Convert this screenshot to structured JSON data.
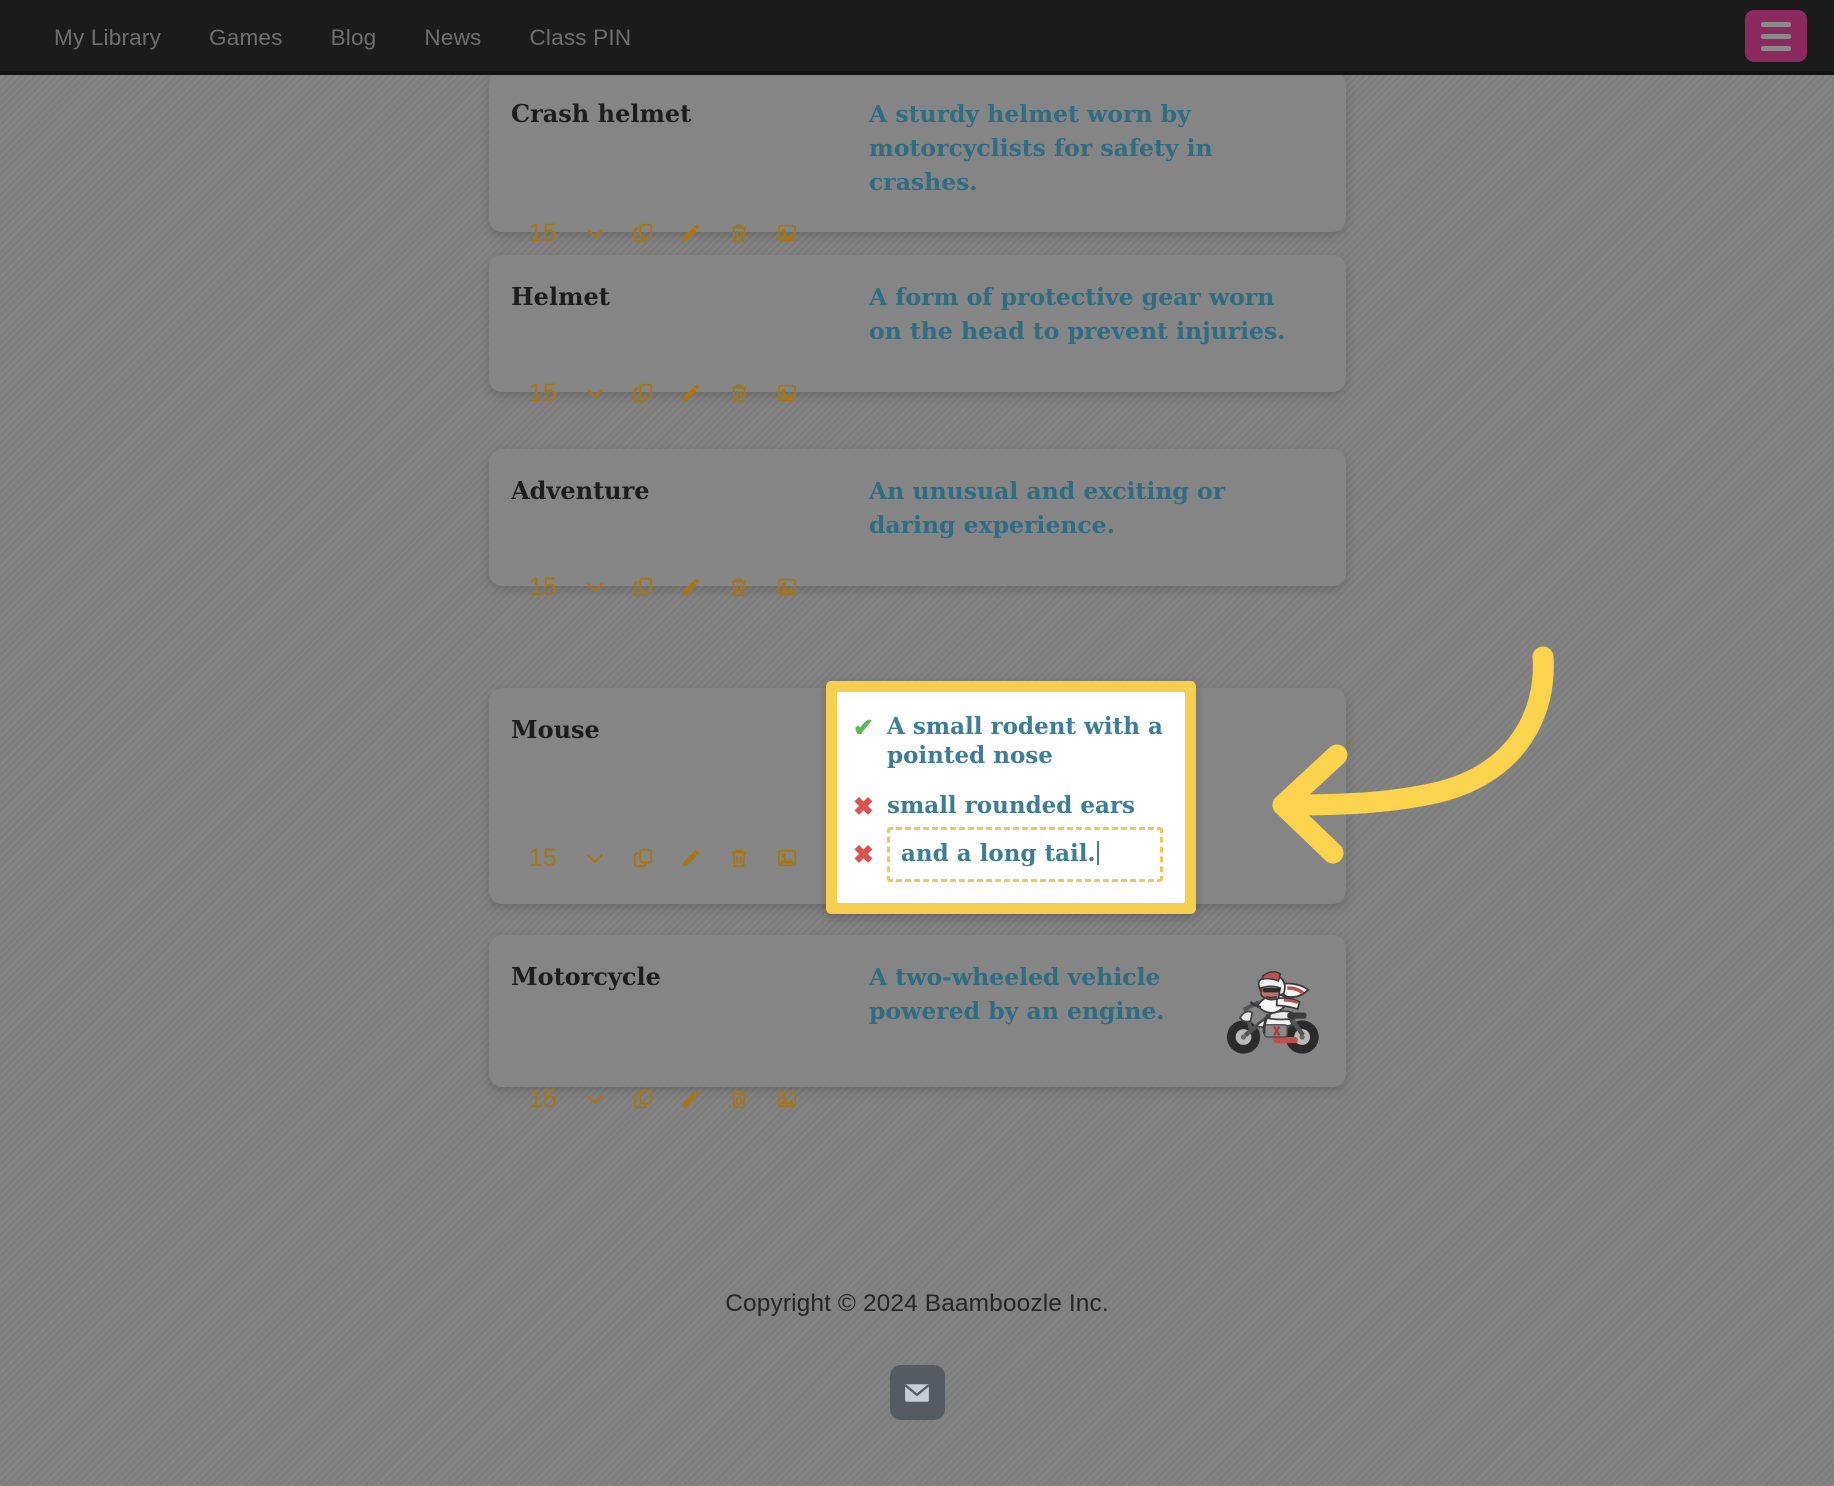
{
  "nav": {
    "links": [
      {
        "label": "My Library",
        "name": "nav-my-library"
      },
      {
        "label": "Games",
        "name": "nav-games"
      },
      {
        "label": "Blog",
        "name": "nav-blog"
      },
      {
        "label": "News",
        "name": "nav-news"
      },
      {
        "label": "Class PIN",
        "name": "nav-class-pin"
      }
    ],
    "menu_button_icon": "hamburger-menu-icon",
    "menu_button_color": "#8c2a5f"
  },
  "cards": [
    {
      "term": "Crash helmet",
      "definition": "A sturdy helmet worn by motorcyclists for safety in crashes.",
      "count": "15",
      "has_image": false
    },
    {
      "term": "Helmet",
      "definition": "A form of protective gear worn on the head to prevent injuries.",
      "count": "15",
      "has_image": false
    },
    {
      "term": "Adventure",
      "definition": "An unusual and exciting or daring experience.",
      "count": "15",
      "has_image": false
    },
    {
      "term": "Mouse",
      "definition": "",
      "count": "15",
      "has_image": false
    },
    {
      "term": "Motorcycle",
      "definition": "A two-wheeled vehicle powered by an engine.",
      "count": "15",
      "has_image": true,
      "image_alt": "motorcyclist-illustration"
    }
  ],
  "toolbar_icons": [
    {
      "name": "chevron-down-icon",
      "label": "chevron-down"
    },
    {
      "name": "copy-icon",
      "label": "copy"
    },
    {
      "name": "pencil-edit-icon",
      "label": "edit"
    },
    {
      "name": "trash-delete-icon",
      "label": "delete"
    },
    {
      "name": "image-picture-icon",
      "label": "image"
    }
  ],
  "popup": {
    "rows": [
      {
        "mark": "✔",
        "mark_type": "ok",
        "text": "A small rodent with a pointed nose",
        "editing": false
      },
      {
        "mark": "✖",
        "mark_type": "fail",
        "text": "small rounded ears",
        "editing": false
      },
      {
        "mark": "✖",
        "mark_type": "fail",
        "text": "and a long tail.",
        "editing": true
      }
    ],
    "border_color": "#f7cf4e",
    "dashed_color": "#efc75e",
    "text_color": "#3d7e96",
    "ok_color": "#5cb85c",
    "fail_color": "#d9534f"
  },
  "annotation": {
    "type": "curved-arrow",
    "direction": "left",
    "color": "#fbd34d"
  },
  "footer": {
    "copyright": "Copyright © 2024 Baamboozle Inc.",
    "email_icon": "envelope-mail-icon"
  },
  "colors": {
    "page_background": "#808080",
    "topbar": "#1b1b1b",
    "card_background": "#858585",
    "icon_gold": "#a8760f",
    "term_text": "#1d1d1d",
    "definition_text": "#2f6d82"
  }
}
